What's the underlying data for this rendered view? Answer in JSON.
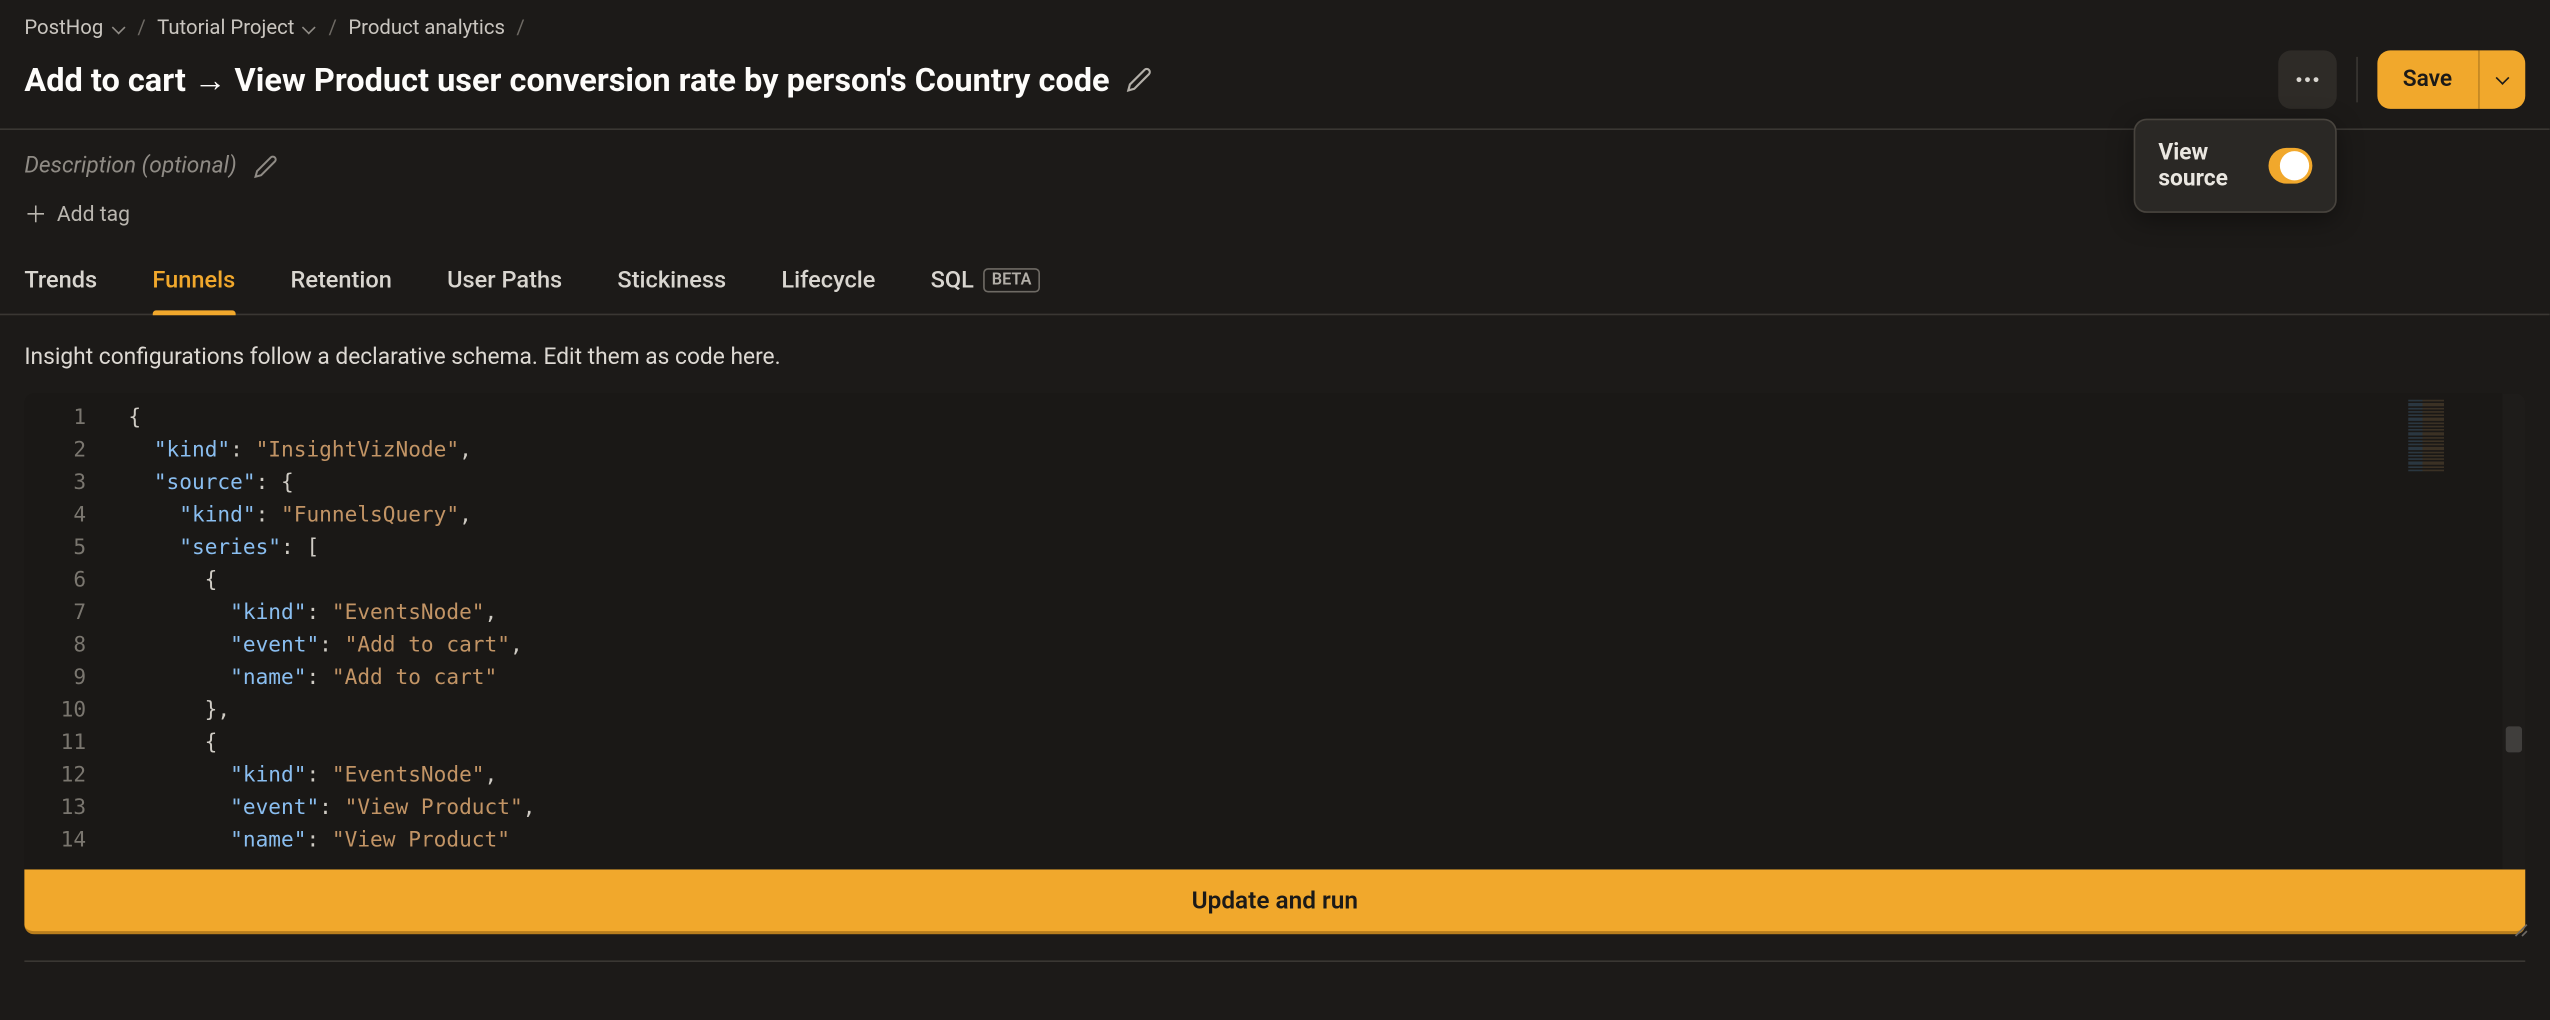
{
  "breadcrumbs": {
    "items": [
      "PostHog",
      "Tutorial Project",
      "Product analytics"
    ]
  },
  "title": "Add to cart → View Product user conversion rate by person's Country code",
  "description_placeholder": "Description (optional)",
  "add_tag_label": "Add tag",
  "actions": {
    "save_label": "Save"
  },
  "popover": {
    "view_source_label": "View source",
    "enabled": true
  },
  "tabs": {
    "items": [
      "Trends",
      "Funnels",
      "Retention",
      "User Paths",
      "Stickiness",
      "Lifecycle",
      "SQL"
    ],
    "active_index": 1,
    "sql_badge": "BETA"
  },
  "subheading": "Insight configurations follow a declarative schema. Edit them as code here.",
  "editor": {
    "line_numbers": [
      "1",
      "2",
      "3",
      "4",
      "5",
      "6",
      "7",
      "8",
      "9",
      "10",
      "11",
      "12",
      "13",
      "14"
    ],
    "tokens": [
      [
        {
          "t": "p",
          "v": "{"
        }
      ],
      [
        {
          "t": "p",
          "v": "  "
        },
        {
          "t": "k",
          "v": "\"kind\""
        },
        {
          "t": "p",
          "v": ": "
        },
        {
          "t": "s",
          "v": "\"InsightVizNode\""
        },
        {
          "t": "p",
          "v": ","
        }
      ],
      [
        {
          "t": "p",
          "v": "  "
        },
        {
          "t": "k",
          "v": "\"source\""
        },
        {
          "t": "p",
          "v": ": {"
        }
      ],
      [
        {
          "t": "p",
          "v": "    "
        },
        {
          "t": "k",
          "v": "\"kind\""
        },
        {
          "t": "p",
          "v": ": "
        },
        {
          "t": "s",
          "v": "\"FunnelsQuery\""
        },
        {
          "t": "p",
          "v": ","
        }
      ],
      [
        {
          "t": "p",
          "v": "    "
        },
        {
          "t": "k",
          "v": "\"series\""
        },
        {
          "t": "p",
          "v": ": ["
        }
      ],
      [
        {
          "t": "p",
          "v": "      {"
        }
      ],
      [
        {
          "t": "p",
          "v": "        "
        },
        {
          "t": "k",
          "v": "\"kind\""
        },
        {
          "t": "p",
          "v": ": "
        },
        {
          "t": "s",
          "v": "\"EventsNode\""
        },
        {
          "t": "p",
          "v": ","
        }
      ],
      [
        {
          "t": "p",
          "v": "        "
        },
        {
          "t": "k",
          "v": "\"event\""
        },
        {
          "t": "p",
          "v": ": "
        },
        {
          "t": "s",
          "v": "\"Add to cart\""
        },
        {
          "t": "p",
          "v": ","
        }
      ],
      [
        {
          "t": "p",
          "v": "        "
        },
        {
          "t": "k",
          "v": "\"name\""
        },
        {
          "t": "p",
          "v": ": "
        },
        {
          "t": "s",
          "v": "\"Add to cart\""
        }
      ],
      [
        {
          "t": "p",
          "v": "      },"
        }
      ],
      [
        {
          "t": "p",
          "v": "      {"
        }
      ],
      [
        {
          "t": "p",
          "v": "        "
        },
        {
          "t": "k",
          "v": "\"kind\""
        },
        {
          "t": "p",
          "v": ": "
        },
        {
          "t": "s",
          "v": "\"EventsNode\""
        },
        {
          "t": "p",
          "v": ","
        }
      ],
      [
        {
          "t": "p",
          "v": "        "
        },
        {
          "t": "k",
          "v": "\"event\""
        },
        {
          "t": "p",
          "v": ": "
        },
        {
          "t": "s",
          "v": "\"View Product\""
        },
        {
          "t": "p",
          "v": ","
        }
      ],
      [
        {
          "t": "p",
          "v": "        "
        },
        {
          "t": "k",
          "v": "\"name\""
        },
        {
          "t": "p",
          "v": ": "
        },
        {
          "t": "s",
          "v": "\"View Product\""
        }
      ]
    ]
  },
  "update_button_label": "Update and run"
}
